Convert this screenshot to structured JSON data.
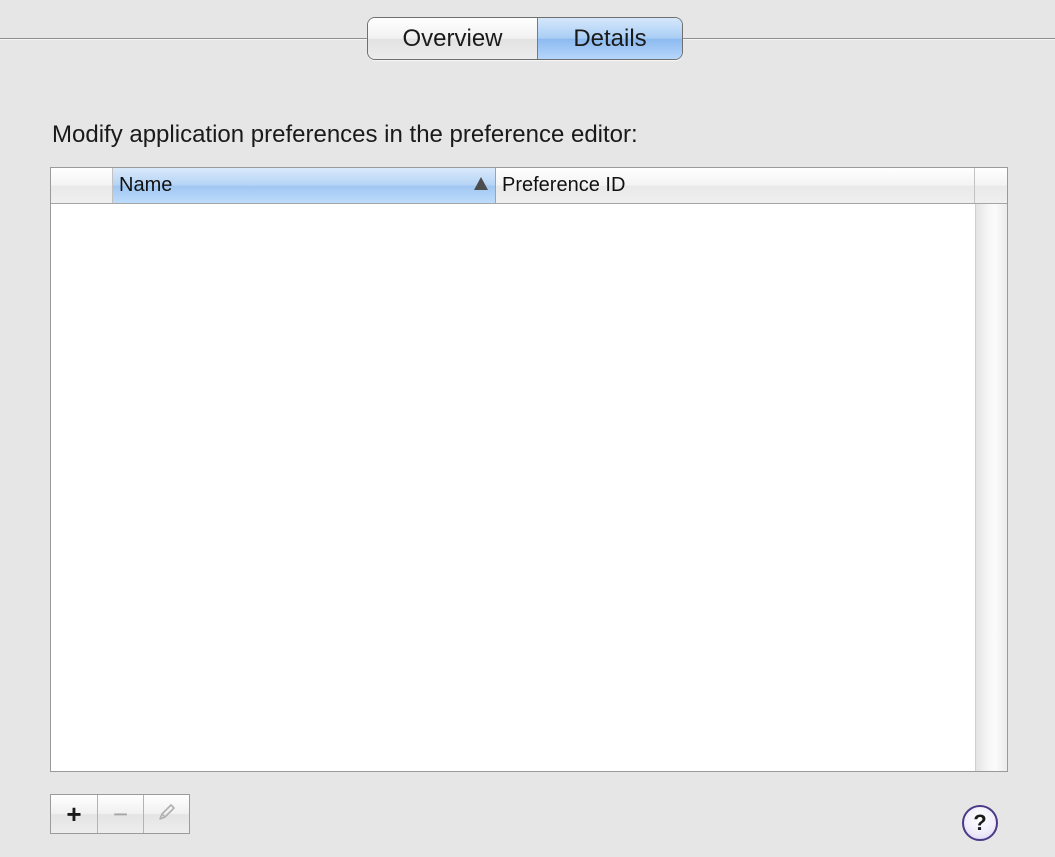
{
  "tabs": [
    {
      "label": "Overview",
      "selected": false
    },
    {
      "label": "Details",
      "selected": true
    }
  ],
  "instruction": "Modify application preferences in the preference editor:",
  "table": {
    "columns": [
      {
        "label": "Name",
        "sorted": true,
        "sort_direction": "ascending"
      },
      {
        "label": "Preference ID",
        "sorted": false
      }
    ],
    "rows": []
  },
  "buttons": {
    "add": "+",
    "remove": "−",
    "edit_icon": "pencil-icon",
    "help": "?"
  },
  "colors": {
    "selected_tab": "#a9cdf5",
    "sorted_column": "#b4d3f5",
    "help_ring": "#4b3a86"
  }
}
